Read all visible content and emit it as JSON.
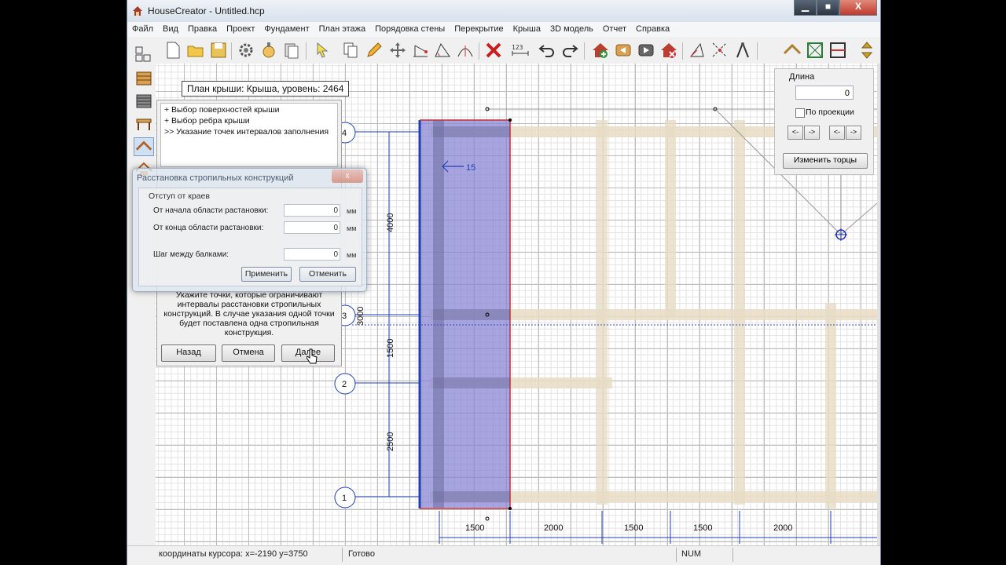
{
  "window": {
    "title": "HouseCreator - Untitled.hcp",
    "controls": {
      "minimize": "▁",
      "maximize": "■",
      "close": "X"
    }
  },
  "menu": [
    "Файл",
    "Вид",
    "Правка",
    "Проект",
    "Фундамент",
    "План этажа",
    "Порядовка стены",
    "Перекрытие",
    "Крыша",
    "3D модель",
    "Отчет",
    "Справка"
  ],
  "toolbar_icons": [
    "floors-icon",
    "new-file-icon",
    "open-folder-icon",
    "save-icon",
    "settings-gear-icon",
    "cut-icon",
    "paste-icon",
    "select-arrow-icon",
    "copy-icon",
    "pencil-icon",
    "move-icon",
    "measure-icon",
    "angle-icon",
    "arc-icon",
    "delete-icon",
    "dimension-icon",
    "undo-icon",
    "redo-icon",
    "house-add-icon",
    "back-icon",
    "forward-icon",
    "house-remove-icon",
    "triangle-measure-icon",
    "nodes-icon",
    "compass-icon",
    "roof-icon",
    "cross-box-icon",
    "split-icon",
    "scroll-arrows-icon"
  ],
  "left_tools": [
    "foundation-icon",
    "wall-icon",
    "floor-icon",
    "roof-tool-icon",
    "roof-elements-icon"
  ],
  "plan_label": "План крыши: Крыша, уровень: 2464",
  "wizard": {
    "steps": [
      "+ Выбор поверхностей крыши",
      "+ Выбор ребра крыши",
      ">> Указание точек интервалов заполнения"
    ],
    "instruction": "Укажите точки, которые ограничивают интервалы расстановки стропильных конструкций. В случае указания одной точки будет поставлена одна стропильная конструкция.",
    "back": "Назад",
    "cancel": "Отмена",
    "next": "Далее"
  },
  "rafter_dialog": {
    "title": "Расстановка стропильных конструкций",
    "close": "x",
    "group": "Отступ от краев",
    "fields": [
      {
        "label": "От начала области растановки:",
        "value": "0",
        "unit": "мм"
      },
      {
        "label": "От конца области растановки:",
        "value": "0",
        "unit": "мм"
      },
      {
        "label": "Шаг между балками:",
        "value": "0",
        "unit": "мм"
      }
    ],
    "apply": "Применить",
    "cancel": "Отменить"
  },
  "right_panel": {
    "length_label": "Длина",
    "length_value": "0",
    "by_projection": "По проекции",
    "arrows": [
      "<-",
      "->",
      "<-",
      "->"
    ],
    "change_ends": "Изменить торцы"
  },
  "drawing": {
    "axis_labels": [
      "4",
      "3",
      "2",
      "1"
    ],
    "vertical_dims": [
      "4000",
      "1500",
      "2500"
    ],
    "overlap_dim": "3000",
    "horizontal_dims": [
      "1500",
      "2000",
      "1500",
      "1500",
      "2000"
    ],
    "marker": "15",
    "colors": {
      "roof_fill": "#8a86d6",
      "beam": "#e7dcc4",
      "dim_line": "#1f3fb4",
      "red_edge": "#c0303a"
    }
  },
  "status": {
    "cursor": "координаты курсора: x=-2190 y=3750",
    "state": "Готово",
    "num": "NUM"
  }
}
